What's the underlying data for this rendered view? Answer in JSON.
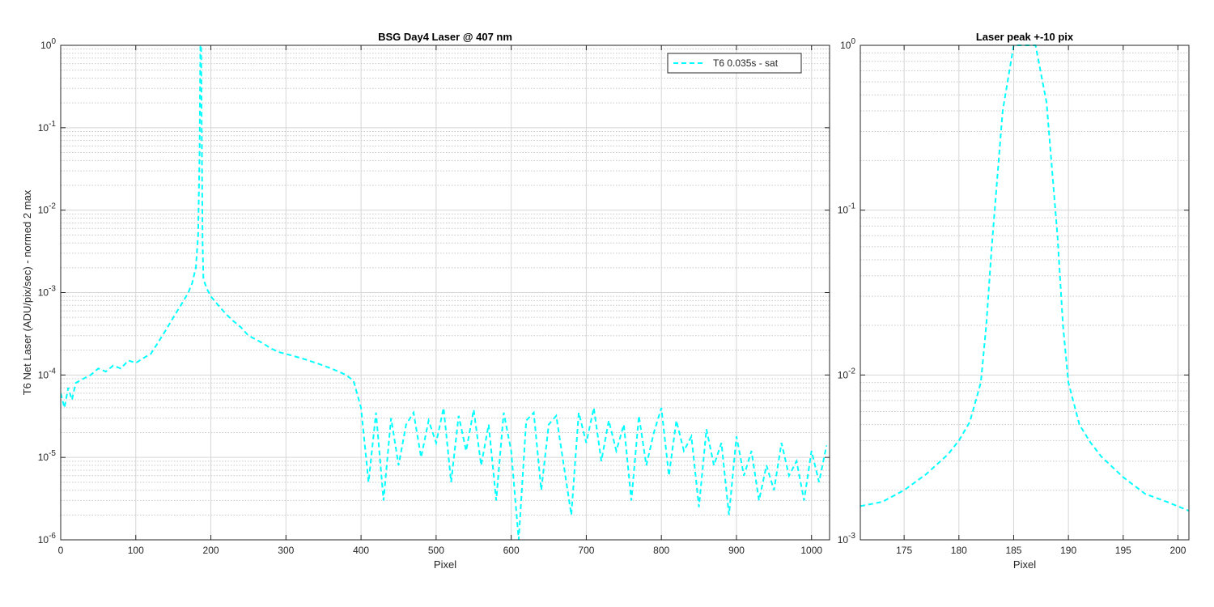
{
  "colors": {
    "series": "#00FFFF",
    "axis": "#262626",
    "grid_major": "#d6d6d6",
    "grid_minor": "#c8c8c8",
    "background": "#ffffff"
  },
  "chart_data": [
    {
      "type": "line",
      "title": "BSG  Day4 Laser @ 407 nm",
      "xlabel": "Pixel",
      "ylabel": "T6 Net Laser (ADU/pix/sec) - normed 2 max",
      "xlim": [
        0,
        1024
      ],
      "ylim": [
        1e-06,
        1
      ],
      "yscale": "log",
      "grid": "on (major and minor)",
      "legend_position": "top-right",
      "x_ticks": [
        0,
        100,
        200,
        300,
        400,
        500,
        600,
        700,
        800,
        900,
        1000
      ],
      "x_tick_labels": [
        "0",
        "100",
        "200",
        "300",
        "400",
        "500",
        "600",
        "700",
        "800",
        "900",
        "1000"
      ],
      "y_ticks": [
        1e-06,
        1e-05,
        0.0001,
        0.001,
        0.01,
        0.1,
        1
      ],
      "y_tick_bases": [
        "10",
        "10",
        "10",
        "10",
        "10",
        "10",
        "10"
      ],
      "y_tick_exponents": [
        "-6",
        "-5",
        "-4",
        "-3",
        "-2",
        "-1",
        "0"
      ],
      "y_tick_plain": [
        "",
        "",
        "",
        "",
        "",
        "",
        "1"
      ],
      "series": [
        {
          "name": "T6 0.035s - sat",
          "style": "dashed",
          "x": [
            0,
            5,
            10,
            15,
            20,
            30,
            40,
            50,
            60,
            70,
            80,
            90,
            100,
            110,
            120,
            130,
            140,
            150,
            160,
            170,
            175,
            180,
            183,
            185,
            186,
            187,
            188,
            189,
            190,
            192,
            195,
            200,
            210,
            220,
            230,
            240,
            250,
            260,
            270,
            280,
            290,
            300,
            310,
            320,
            330,
            340,
            350,
            360,
            370,
            380,
            390,
            400,
            410,
            420,
            430,
            440,
            450,
            460,
            470,
            480,
            490,
            500,
            510,
            520,
            530,
            540,
            550,
            560,
            570,
            580,
            590,
            600,
            610,
            620,
            630,
            640,
            650,
            660,
            670,
            680,
            690,
            700,
            710,
            720,
            730,
            740,
            750,
            760,
            770,
            780,
            790,
            800,
            810,
            820,
            830,
            840,
            850,
            860,
            870,
            880,
            890,
            900,
            910,
            920,
            930,
            940,
            950,
            960,
            970,
            980,
            990,
            1000,
            1010,
            1020
          ],
          "y": [
            6e-05,
            4e-05,
            7e-05,
            5e-05,
            8e-05,
            9e-05,
            0.0001,
            0.00012,
            0.00011,
            0.00013,
            0.00012,
            0.00015,
            0.00014,
            0.00016,
            0.00018,
            0.00025,
            0.00035,
            0.0005,
            0.0007,
            0.001,
            0.0013,
            0.002,
            0.005,
            0.05,
            1,
            1,
            0.06,
            0.004,
            0.0015,
            0.0013,
            0.0011,
            0.0009,
            0.0007,
            0.00055,
            0.00045,
            0.00038,
            0.0003,
            0.00027,
            0.00024,
            0.00021,
            0.00019,
            0.00018,
            0.00017,
            0.00016,
            0.00015,
            0.00014,
            0.00013,
            0.00012,
            0.00011,
            0.0001,
            8.5e-05,
            4e-05,
            5e-06,
            3.5e-05,
            3e-06,
            3e-05,
            8e-06,
            2.5e-05,
            3.5e-05,
            1e-05,
            2.8e-05,
            1.5e-05,
            4e-05,
            5e-06,
            3.2e-05,
            1.2e-05,
            3.8e-05,
            8e-06,
            2.5e-05,
            3e-06,
            3.5e-05,
            1.2e-05,
            1e-06,
            2.8e-05,
            3.5e-05,
            4e-06,
            2.5e-05,
            3.2e-05,
            8e-06,
            2e-06,
            3.5e-05,
            1.5e-05,
            4e-05,
            9e-06,
            2.8e-05,
            1.2e-05,
            2.5e-05,
            3e-06,
            3.2e-05,
            8e-06,
            2e-05,
            4e-05,
            6e-06,
            2.8e-05,
            1.2e-05,
            1.8e-05,
            2.5e-06,
            2.2e-05,
            8e-06,
            1.5e-05,
            2e-06,
            1.8e-05,
            6e-06,
            1.2e-05,
            3e-06,
            8e-06,
            4e-06,
            1.5e-05,
            6e-06,
            9e-06,
            3e-06,
            1.2e-05,
            5e-06,
            1.4e-05
          ]
        }
      ]
    },
    {
      "type": "line",
      "title": "Laser peak +-10 pix",
      "xlabel": "Pixel",
      "ylabel": "",
      "xlim": [
        171,
        201
      ],
      "ylim": [
        0.001,
        1
      ],
      "yscale": "log",
      "grid": "on (major and minor)",
      "x_ticks": [
        175,
        180,
        185,
        190,
        195,
        200
      ],
      "x_tick_labels": [
        "175",
        "180",
        "185",
        "190",
        "195",
        "200"
      ],
      "y_ticks": [
        0.001,
        0.01,
        0.1,
        1
      ],
      "y_tick_bases": [
        "10",
        "10",
        "10",
        "10"
      ],
      "y_tick_exponents": [
        "-3",
        "-2",
        "-1",
        "0"
      ],
      "y_tick_plain": [
        "",
        "",
        "",
        "1"
      ],
      "series": [
        {
          "style": "dashed",
          "x": [
            171,
            173,
            175,
            177,
            179,
            180,
            181,
            182,
            182.5,
            183,
            184,
            185,
            186,
            187,
            188,
            189,
            189.5,
            190,
            191,
            192,
            193,
            195,
            197,
            199,
            201
          ],
          "y": [
            0.0016,
            0.0017,
            0.002,
            0.0025,
            0.0033,
            0.004,
            0.0052,
            0.009,
            0.02,
            0.06,
            0.4,
            1,
            1,
            1,
            0.45,
            0.07,
            0.02,
            0.009,
            0.005,
            0.0039,
            0.0032,
            0.0024,
            0.0019,
            0.0017,
            0.0015
          ]
        }
      ]
    }
  ]
}
